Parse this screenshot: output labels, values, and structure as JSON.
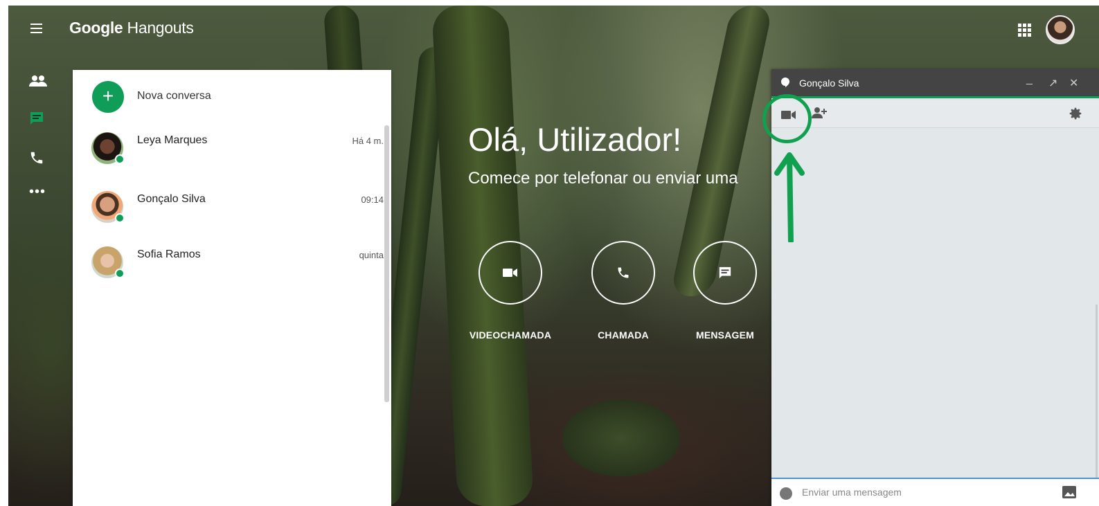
{
  "app": {
    "brand_prefix": "Google",
    "brand_name": "Hangouts"
  },
  "left_rail": {
    "items": [
      {
        "icon": "people-icon"
      },
      {
        "icon": "chat-icon",
        "active": true
      },
      {
        "icon": "phone-icon"
      },
      {
        "icon": "more-icon",
        "label": "•••"
      }
    ]
  },
  "conversations": {
    "new_label": "Nova conversa",
    "items": [
      {
        "name": "Leya Marques",
        "time": "Há 4 m.",
        "online": true
      },
      {
        "name": "Gonçalo Silva",
        "time": "09:14",
        "online": true
      },
      {
        "name": "Sofia Ramos",
        "time": "quinta",
        "online": true
      }
    ]
  },
  "welcome": {
    "title": "Olá, Utilizador!",
    "subtitle": "Comece por telefonar ou enviar uma"
  },
  "actions": [
    {
      "label": "VIDEOCHAMADA",
      "icon": "video-camera-icon"
    },
    {
      "label": "CHAMADA",
      "icon": "phone-icon"
    },
    {
      "label": "MENSAGEM",
      "icon": "message-icon"
    }
  ],
  "chat": {
    "title": "Gonçalo Silva",
    "minimize": "_",
    "popout": "↗",
    "close": "✕",
    "input_placeholder": "Enviar uma mensagem"
  },
  "colors": {
    "accent": "#0f9d58",
    "chat_header": "#444444",
    "annotation": "#10a04f"
  }
}
